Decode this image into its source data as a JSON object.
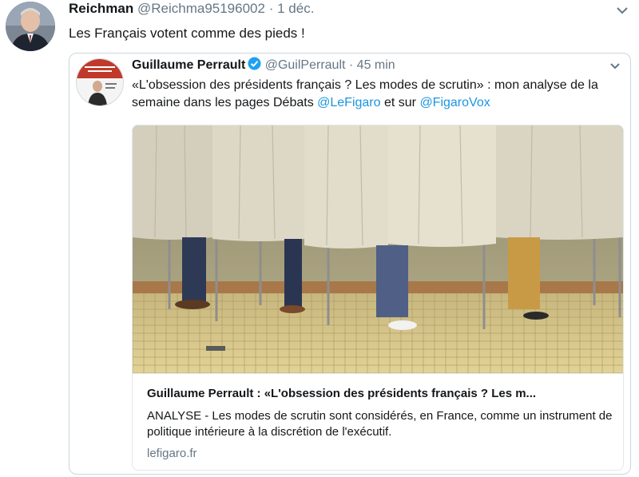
{
  "tweet": {
    "author_name": "Reichman",
    "author_handle": "@Reichma95196002",
    "separator": "·",
    "time": "1 déc.",
    "text": "Les Français votent comme des pieds !"
  },
  "quoted": {
    "author_name": "Guillaume Perrault",
    "author_handle": "@GuilPerrault",
    "separator": "·",
    "time": "45 min",
    "text_part1": "«L'obsession des présidents français ? Les modes de scrutin» : mon analyse de la semaine dans les pages Débats ",
    "mention1": "@LeFigaro",
    "text_part2": " et sur ",
    "mention2": "@FigaroVox"
  },
  "card": {
    "title": "Guillaume Perrault : «L'obsession des présidents français ? Les m...",
    "description": "ANALYSE - Les modes de scrutin sont considérés, en France, comme un instrument de politique intérieure à la discrétion de l'exécutif.",
    "domain": "lefigaro.fr"
  },
  "colors": {
    "link": "#1b95e0",
    "secondary_text": "#657786",
    "verified": "#1da1f2",
    "border": "#ccd6dd"
  }
}
